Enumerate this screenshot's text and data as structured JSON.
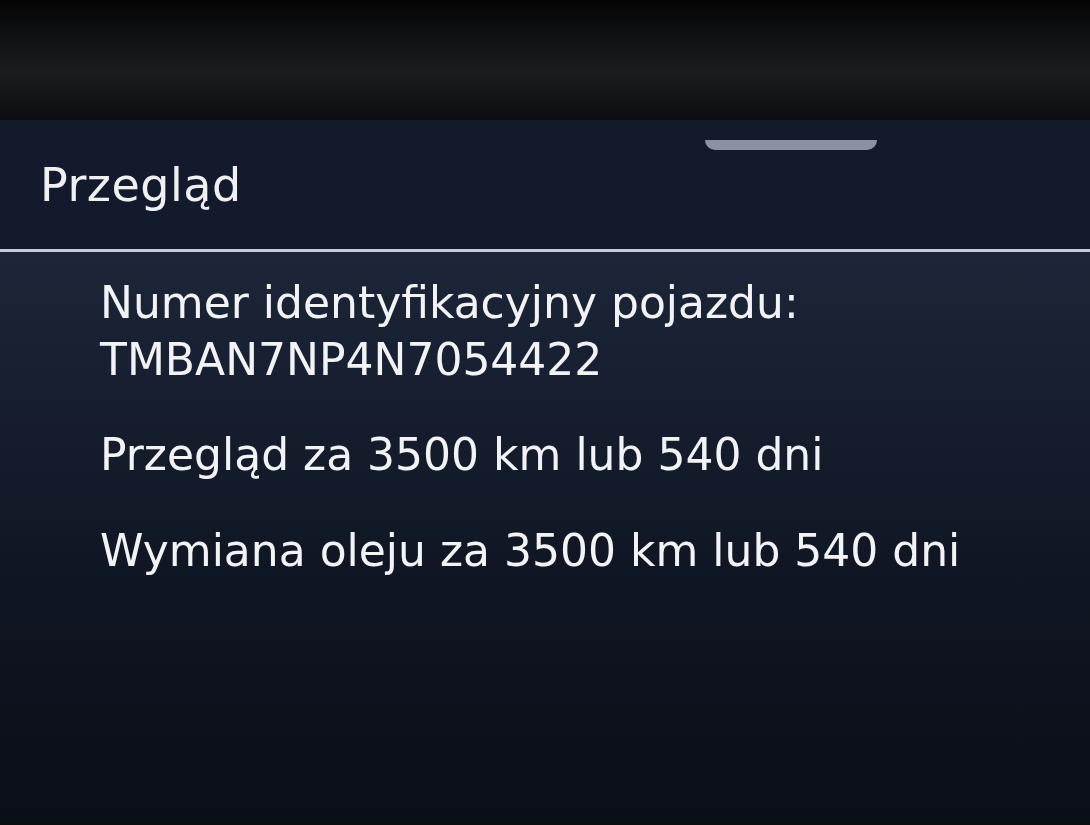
{
  "header": {
    "title": "Przegląd"
  },
  "details": {
    "vin_label": "Numer identyfikacyjny pojazdu:",
    "vin": "TMBAN7NP4N7054422"
  },
  "notices": [
    {
      "text": "Przegląd za 3500 km lub 540 dni"
    },
    {
      "text": "Wymiana oleju za 3500 km lub 540 dni"
    }
  ]
}
